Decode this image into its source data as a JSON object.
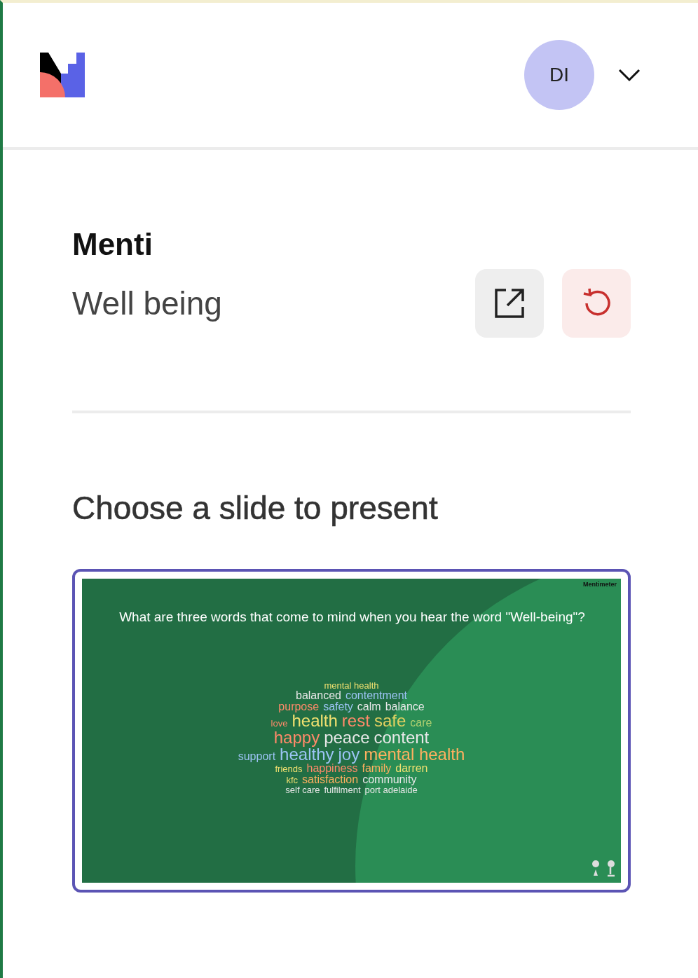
{
  "header": {
    "avatar": {
      "initials": "DI"
    }
  },
  "presentation": {
    "owner": "Menti",
    "title": "Well being"
  },
  "section_title": "Choose a slide to present",
  "slides": [
    {
      "selected": true,
      "brand": "Mentimeter",
      "question": "What are three words that come to mind when you hear the word \"Well-being\"?",
      "word_cloud": [
        [
          {
            "text": "mental health",
            "color": "#f0e070",
            "kind": "small"
          }
        ],
        [
          {
            "text": "balanced",
            "color": "#e8e8e8",
            "kind": "medium"
          },
          {
            "text": "contentment",
            "color": "#9cc4f4",
            "kind": "medium"
          }
        ],
        [
          {
            "text": "purpose",
            "color": "#ff8a6a",
            "kind": "medium"
          },
          {
            "text": "safety",
            "color": "#9cc4f4",
            "kind": "medium"
          },
          {
            "text": "calm",
            "color": "#e8e8e8",
            "kind": "medium"
          },
          {
            "text": "balance",
            "color": "#e8e8e8",
            "kind": "medium"
          }
        ],
        [
          {
            "text": "love",
            "color": "#ff8a6a",
            "kind": "small"
          },
          {
            "text": "health",
            "color": "#f0e070",
            "kind": "large"
          },
          {
            "text": "rest",
            "color": "#ff8a6a",
            "kind": "large"
          },
          {
            "text": "safe",
            "color": "#e0d060",
            "kind": "large"
          },
          {
            "text": "care",
            "color": "#b0d070",
            "kind": "medium"
          }
        ],
        [
          {
            "text": "happy",
            "color": "#ff8a6a",
            "kind": "large"
          },
          {
            "text": "peace",
            "color": "#e8e8e8",
            "kind": "large"
          },
          {
            "text": "content",
            "color": "#e8e8e8",
            "kind": "large"
          }
        ],
        [
          {
            "text": "support",
            "color": "#9cc4f4",
            "kind": "medium"
          },
          {
            "text": "healthy",
            "color": "#9cc4f4",
            "kind": "large"
          },
          {
            "text": "joy",
            "color": "#9cc4f4",
            "kind": "large"
          },
          {
            "text": "mental health",
            "color": "#ffb060",
            "kind": "large"
          }
        ],
        [
          {
            "text": "friends",
            "color": "#f0e070",
            "kind": "small"
          },
          {
            "text": "happiness",
            "color": "#ff8a6a",
            "kind": "medium"
          },
          {
            "text": "family",
            "color": "#ffb060",
            "kind": "medium"
          },
          {
            "text": "darren",
            "color": "#f0e070",
            "kind": "medium"
          }
        ],
        [
          {
            "text": "kfc",
            "color": "#f0e070",
            "kind": "small"
          },
          {
            "text": "satisfaction",
            "color": "#ffb060",
            "kind": "medium"
          },
          {
            "text": "community",
            "color": "#e8e8e8",
            "kind": "medium"
          }
        ],
        [
          {
            "text": "self care",
            "color": "#e8e8e8",
            "kind": "small"
          },
          {
            "text": "fulfilment",
            "color": "#e8e8e8",
            "kind": "small"
          },
          {
            "text": "port adelaide",
            "color": "#e8e8e8",
            "kind": "small"
          }
        ]
      ]
    }
  ]
}
